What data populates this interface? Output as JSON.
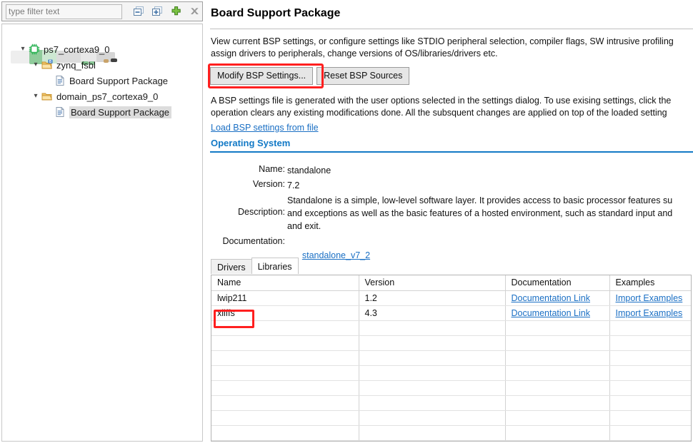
{
  "left_pane": {
    "filter": {
      "placeholder": "type filter text",
      "value": ""
    },
    "toolbar": [
      {
        "name": "collapse-all-icon",
        "label": "Collapse All"
      },
      {
        "name": "expand-all-icon",
        "label": "Expand All"
      },
      {
        "name": "add-icon",
        "label": "Add"
      },
      {
        "name": "delete-icon",
        "label": "Delete"
      }
    ],
    "tree": [
      {
        "label": "",
        "redacted": true,
        "indent": 0,
        "icon": "none",
        "expander": "none",
        "selected": false
      },
      {
        "label": "ps7_cortexa9_0",
        "indent": 1,
        "icon": "processor-chip-icon",
        "expander": "expanded",
        "selected": false
      },
      {
        "label": "zynq_fsbl",
        "indent": 2,
        "icon": "folder-bsp-icon",
        "expander": "expanded",
        "selected": false
      },
      {
        "label": "Board Support Package",
        "indent": 3,
        "icon": "document-icon",
        "expander": "none",
        "selected": false
      },
      {
        "label": "domain_ps7_cortexa9_0",
        "indent": 2,
        "icon": "folder-icon",
        "expander": "expanded",
        "selected": false
      },
      {
        "label": "Board Support Package",
        "indent": 3,
        "icon": "document-icon",
        "expander": "none",
        "selected": true
      }
    ]
  },
  "main": {
    "title": "Board Support Package",
    "description_1": "View current BSP settings, or configure settings like STDIO peripheral selection, compiler flags, SW intrusive profiling\nassign drivers to peripherals, change versions of OS/libraries/drivers etc.",
    "buttons": {
      "modify": "Modify BSP Settings...",
      "reset": "Reset BSP Sources"
    },
    "description_2": "A BSP settings file is generated with the user options selected in the settings dialog. To use exising settings, click the\noperation clears any existing modifications done. All the subsquent changes are applied on top of the loaded setting",
    "load_link": "Load BSP settings from file",
    "section_heading": "Operating System",
    "os": {
      "name_label": "Name:",
      "name_value": "standalone",
      "version_label": "Version:",
      "version_value": "7.2",
      "description_label": "Description:",
      "description_value": "Standalone is a simple, low-level software layer. It provides access to basic processor features su\nand exceptions as well as the basic features of a hosted environment, such as standard input and\nand exit.",
      "documentation_label": "Documentation:",
      "documentation_link": "standalone_v7_2"
    },
    "tabs": [
      {
        "label": "Drivers",
        "active": false
      },
      {
        "label": "Libraries",
        "active": true
      }
    ],
    "table": {
      "columns": [
        "Name",
        "Version",
        "Documentation",
        "Examples"
      ],
      "rows": [
        {
          "name": "lwip211",
          "version": "1.2",
          "documentation": "Documentation Link",
          "examples": "Import Examples"
        },
        {
          "name": "xilffs",
          "version": "4.3",
          "documentation": "Documentation Link",
          "examples": "Import Examples"
        }
      ],
      "empty_rows": 8
    }
  },
  "highlights": {
    "color": "#ff1f1f",
    "targets": [
      "modify-bsp-settings-button",
      "library-name-xilffs"
    ]
  },
  "colors": {
    "link": "#1a6fc4",
    "section_heading": "#1279c6",
    "highlight": "#ff1f1f",
    "selection": "#dcdcdc"
  }
}
